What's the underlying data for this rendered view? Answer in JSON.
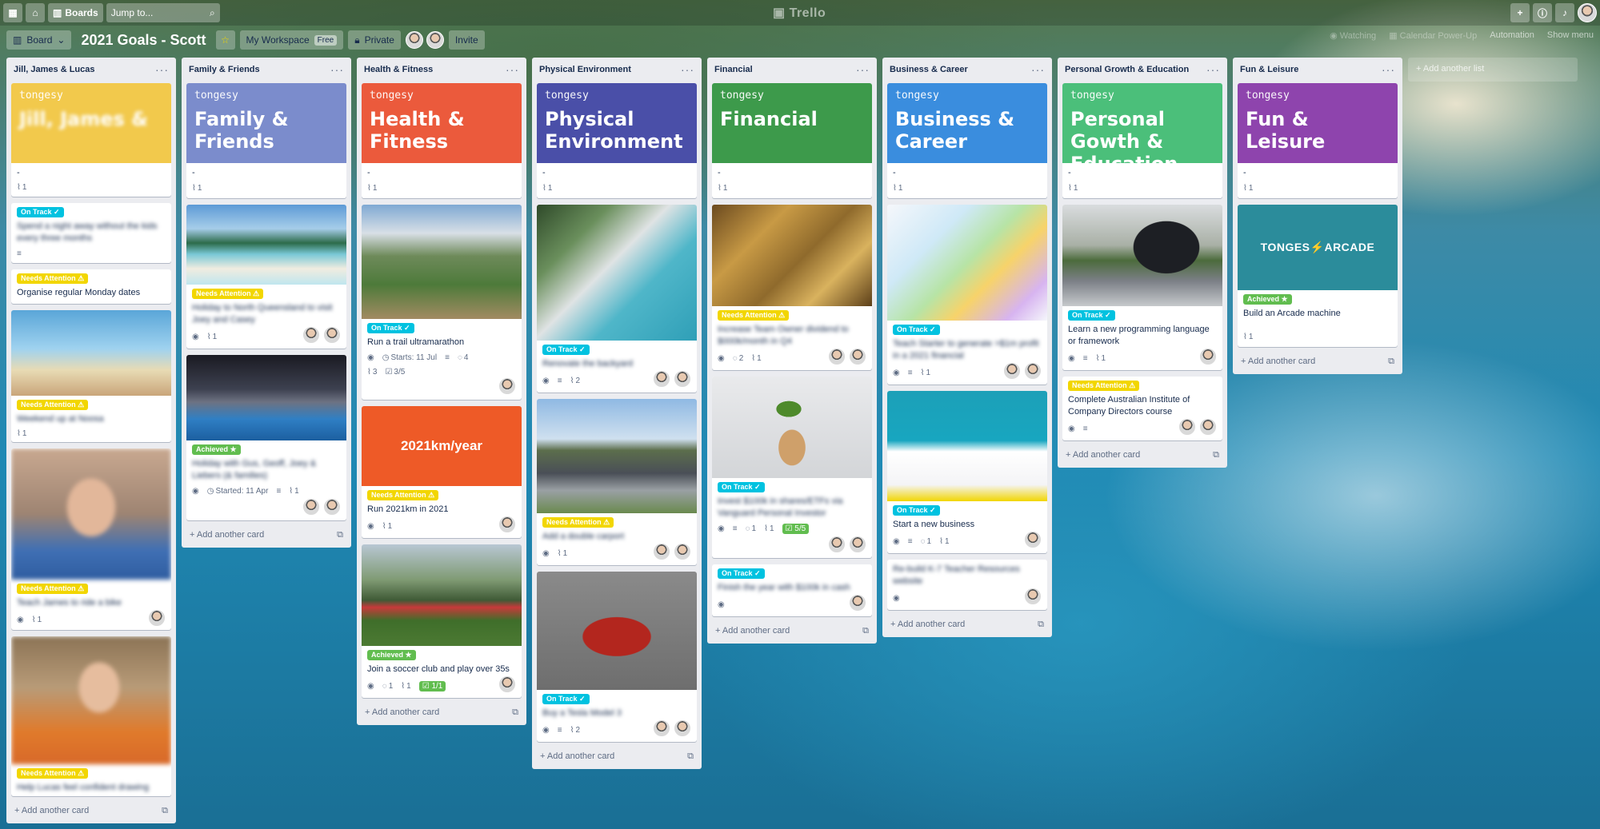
{
  "topbar": {
    "apps_icon": "grid-icon",
    "home_icon": "home-icon",
    "boards_label": "Boards",
    "search_placeholder": "Jump to...",
    "logo": "Trello"
  },
  "boardbar": {
    "view_label": "Board",
    "board_name": "2021 Goals - Scott",
    "workspace_label": "My Workspace",
    "workspace_badge": "Free",
    "visibility_label": "Private",
    "invite_label": "Invite",
    "watching_label": "Watching",
    "powerup_label": "Calendar Power-Up",
    "automation_label": "Automation",
    "menu_label": "Show menu"
  },
  "common": {
    "add_card": "Add another card",
    "add_list": "Add another list",
    "cover_brand": "tongesy",
    "dash": "-",
    "one": "1"
  },
  "labels": {
    "on_track": "On Track ✓",
    "needs_attention": "Needs Attention ⚠",
    "achieved": "Achieved ★"
  },
  "colors": {
    "yellow": "#f2c94c",
    "purple_blue": "#7b8ccc",
    "orange": "#eb5a3c",
    "indigo": "#4a4fa8",
    "green": "#3d9a4b",
    "blue": "#3a8dde",
    "teal_green": "#4bbf7a",
    "violet": "#8e44ad",
    "label_track": "#00c2e0",
    "label_attention": "#f2d600",
    "label_achieved": "#61bd4f"
  },
  "lists": {
    "jill": {
      "title": "Jill, James & Lucas",
      "card_monday": "Organise regular Monday dates",
      "card_blur_1": "Spend a night away without the kids every three months",
      "card_blur_2": "Weekend up at Noosa",
      "card_blur_3": "Teach James to ride a bike",
      "card_blur_4": "Help Lucas feel confident drawing"
    },
    "family": {
      "title": "Family & Friends",
      "cover": "Family & Friends",
      "card_blur_1": "Holiday to North Queensland to visit Joey and Casey",
      "card_blur_2": "Holiday with Gus, Geoff, Joey & Liebers (& families)",
      "started": "Started: 11 Apr"
    },
    "health": {
      "title": "Health & Fitness",
      "cover": "Health & Fitness",
      "card_trail": "Run a trail ultramarathon",
      "starts": "Starts: 11 Jul",
      "comments": "4",
      "attachments": "3",
      "checklist": "3/5",
      "banner": "2021km/year",
      "card_2021": "Run 2021km in 2021",
      "card_soccer": "Join a soccer club and play over 35s",
      "soccer_checklist": "1/1"
    },
    "physical": {
      "title": "Physical Environment",
      "cover": "Physical Environment",
      "card_blur_1": "Renovate the backyard",
      "card_blur_2": "Add a double carport",
      "card_blur_3": "Buy a Tesla Model 3",
      "two": "2"
    },
    "financial": {
      "title": "Financial",
      "cover": "Financial",
      "card_blur_1": "Increase Team Owner dividend to $000k/month in Q4",
      "card_blur_2": "Invest $100k in shares/ETFs via Vanguard Personal Investor",
      "card_blur_3": "Finish the year with $100k in cash",
      "checklist": "5/5",
      "two": "2"
    },
    "business": {
      "title": "Business & Career",
      "cover": "Business & Career",
      "card_blur_1": "Teach Starter to generate >$1m profit in a 2021 financial",
      "card_new_business": "Start a new business",
      "card_blur_2": "Re-build K-7 Teacher Resources website"
    },
    "personal": {
      "title": "Personal Growth & Education",
      "cover": "Personal Gowth & Education",
      "card_programming": "Learn a new programming language or framework",
      "card_directors": "Complete Australian Institute of Company Directors course"
    },
    "fun": {
      "title": "Fun & Leisure",
      "cover": "Fun & Leisure",
      "arcade_banner": "TONGES⚡ARCADE",
      "card_arcade": "Build an Arcade machine"
    }
  }
}
